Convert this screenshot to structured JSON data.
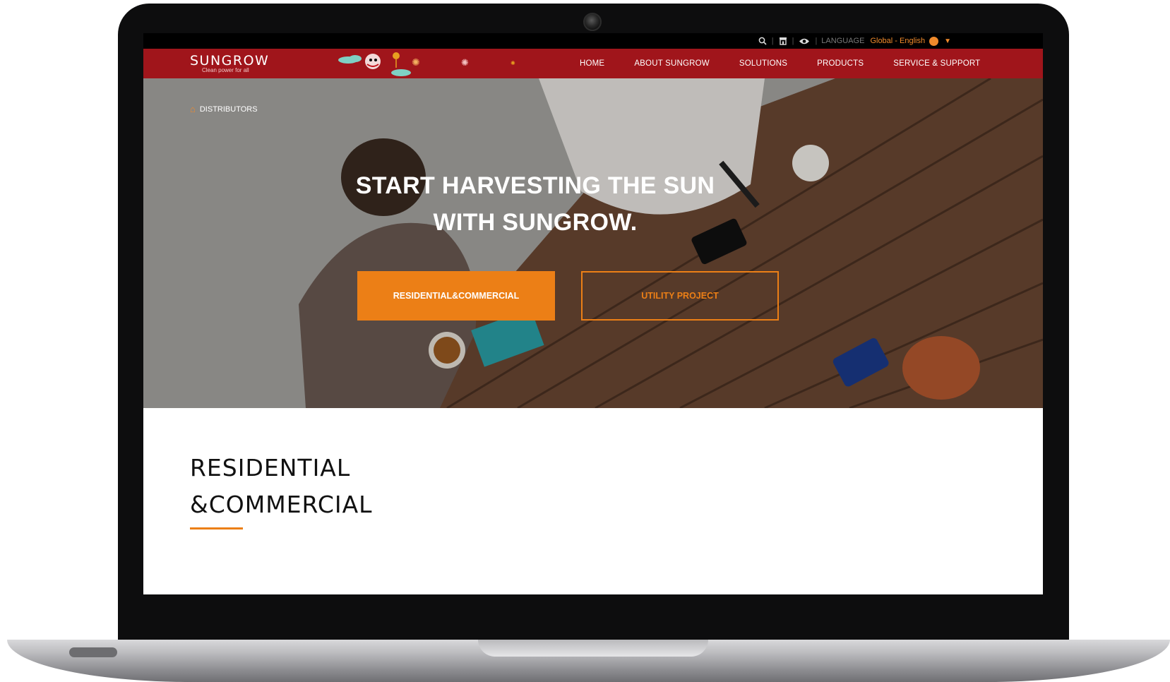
{
  "topbar": {
    "icons": [
      "search-icon",
      "store-icon",
      "eye-icon"
    ],
    "language_label": "LANGUAGE",
    "language_value": "Global - English"
  },
  "brand": {
    "name": "SUNGROW",
    "tagline": "Clean power for all"
  },
  "nav": {
    "items": [
      "HOME",
      "ABOUT SUNGROW",
      "SOLUTIONS",
      "PRODUCTS",
      "SERVICE & SUPPORT"
    ]
  },
  "hero": {
    "breadcrumb": "DISTRIBUTORS",
    "headline_line1": "START HARVESTING THE SUN",
    "headline_line2": "WITH SUNGROW.",
    "button_primary": "RESIDENTIAL&COMMERCIAL",
    "button_secondary": "UTILITY PROJECT"
  },
  "section": {
    "title_line1": "RESIDENTIAL",
    "title_line2": "&COMMERCIAL"
  },
  "colors": {
    "brand_red": "#a0151b",
    "accent_orange": "#ec7f16"
  }
}
